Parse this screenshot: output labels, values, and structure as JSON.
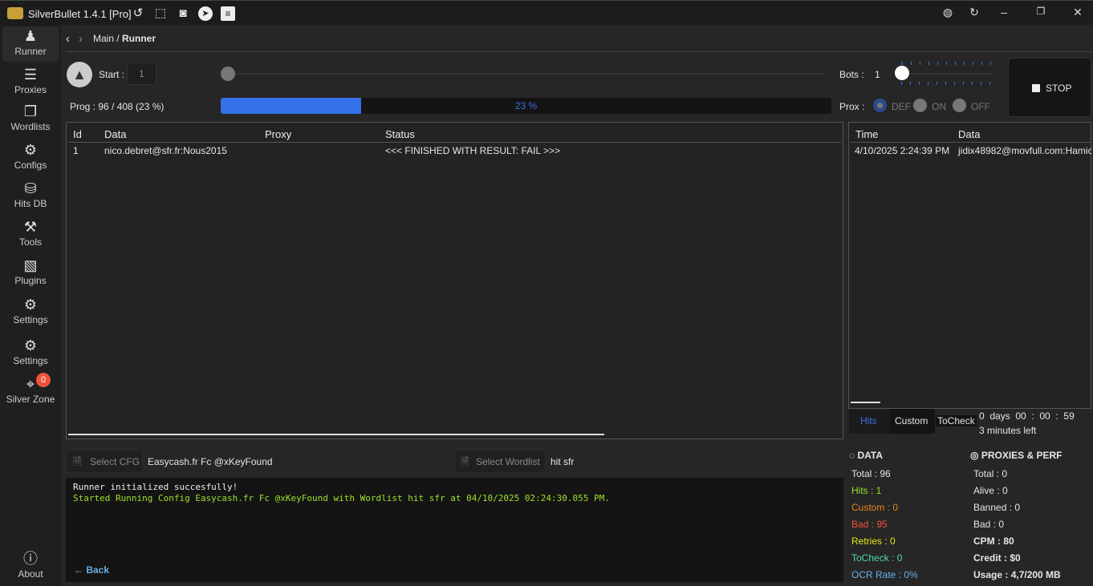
{
  "app": {
    "title": "SilverBullet 1.4.1 [Pro]",
    "logo_text": "SB"
  },
  "titlebar_icons": [
    "history-icon",
    "screenshot-icon",
    "discord-icon",
    "telegram-icon",
    "notes-icon"
  ],
  "sidebar": {
    "items": [
      {
        "label": "Runner",
        "icon": "worker-icon"
      },
      {
        "label": "Proxies",
        "icon": "server-icon"
      },
      {
        "label": "Wordlists",
        "icon": "copy-icon"
      },
      {
        "label": "Configs",
        "icon": "gear-icon"
      },
      {
        "label": "Hits DB",
        "icon": "database-icon"
      },
      {
        "label": "Tools",
        "icon": "tools-icon"
      },
      {
        "label": "Plugins",
        "icon": "puzzle-icon"
      },
      {
        "label": "Settings",
        "icon": "sb-settings-icon"
      },
      {
        "label": "Settings",
        "icon": "core-settings-icon"
      },
      {
        "label": "Silver Zone",
        "icon": "map-pin-icon",
        "badge": "0"
      }
    ],
    "about": "About"
  },
  "breadcrumb": {
    "main": "Main / ",
    "current": "Runner"
  },
  "runner": {
    "start_label": "Start :",
    "start_value": "1",
    "bots_label": "Bots :",
    "bots_value": "1",
    "prog_label": "Prog : 96 / 408 (23 %)",
    "progress_percent": 23,
    "progress_text": "23 %",
    "prox_label": "Prox :",
    "prox_options": [
      "DEF",
      "ON",
      "OFF"
    ],
    "prox_selected": "DEF",
    "stop_label": "STOP"
  },
  "table": {
    "columns": [
      "Id",
      "Data",
      "Proxy",
      "Status"
    ],
    "rows": [
      {
        "id": "1",
        "data": "nico.debret@sfr.fr:Nous2015",
        "proxy": "",
        "status": "<<< FINISHED WITH RESULT: FAIL >>>"
      }
    ]
  },
  "hits_table": {
    "columns": [
      "Time",
      "Data"
    ],
    "rows": [
      {
        "time": "4/10/2025 2:24:39 PM",
        "data": "jidix48982@movfull.com:Hamic"
      }
    ]
  },
  "hits_tabs": [
    "Hits",
    "Custom",
    "ToCheck"
  ],
  "timer": {
    "elapsed": "0  days  00  :  00  :  59",
    "left": "3 minutes left"
  },
  "select": {
    "cfg_button": "Select CFG",
    "cfg_value": "Easycash.fr Fc @xKeyFound",
    "wordlist_button": "Select Wordlist",
    "wordlist_value": "hit sfr"
  },
  "console": {
    "lines": [
      "Runner initialized succesfully!",
      "Started Running Config Easycash.fr Fc @xKeyFound with Wordlist hit sfr at 04/10/2025 02:24:30.055 PM."
    ],
    "back": "Back"
  },
  "data_stats": {
    "title": "DATA",
    "items": [
      {
        "label": "Total : ",
        "value": "96",
        "color": "#e6e6e6"
      },
      {
        "label": "Hits : ",
        "value": "1",
        "color": "#9be02a"
      },
      {
        "label": "Custom : ",
        "value": "0",
        "color": "#e8821a"
      },
      {
        "label": "Bad : ",
        "value": "95",
        "color": "#f0533a"
      },
      {
        "label": "Retries : ",
        "value": "0",
        "color": "#e8e81a"
      },
      {
        "label": "ToCheck : ",
        "value": "0",
        "color": "#4fd6b0"
      },
      {
        "label": "OCR Rate : ",
        "value": "0%",
        "color": "#6aaee8"
      }
    ]
  },
  "perf_stats": {
    "title": "PROXIES & PERF",
    "items": [
      {
        "label": "Total : ",
        "value": "0"
      },
      {
        "label": "Alive : ",
        "value": "0"
      },
      {
        "label": "Banned : ",
        "value": "0"
      },
      {
        "label": "Bad : ",
        "value": "0"
      },
      {
        "label": "CPM : ",
        "value": "80",
        "bold": true
      },
      {
        "label": "Credit : ",
        "value": "$0",
        "bold": true
      },
      {
        "label": "Usage : ",
        "value": "4,7/200 MB",
        "bold": true
      }
    ]
  },
  "colors": {
    "accent": "#3470e8",
    "hits_tab": "#3f6fe0",
    "console_green": "#9be02a"
  }
}
